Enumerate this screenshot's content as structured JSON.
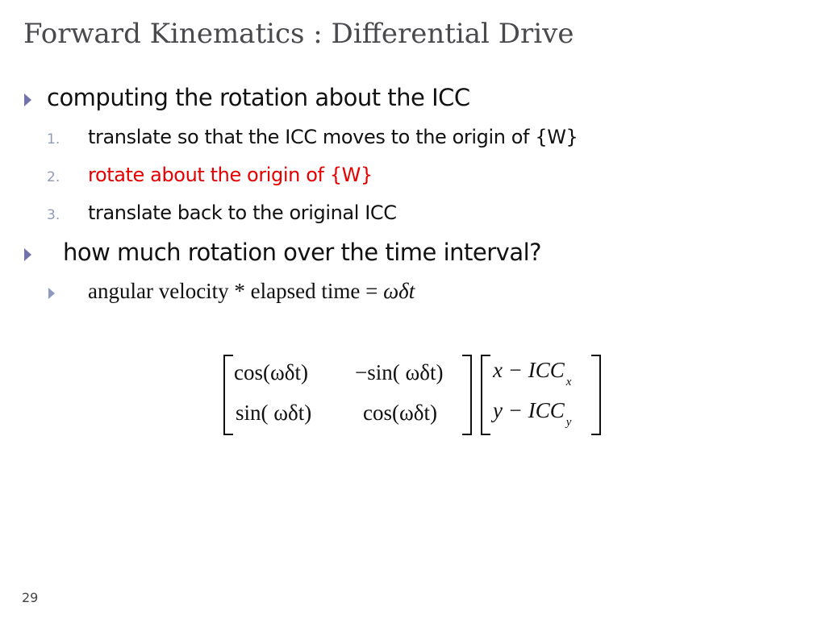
{
  "slide": {
    "title": "Forward Kinematics : Differential Drive",
    "page_number": "29",
    "colors": {
      "title": "#4a4a4e",
      "bullet": "#7174a8",
      "number": "#8e9bb3",
      "highlight": "#e60000",
      "text": "#111111"
    }
  },
  "bullets": [
    {
      "icon": "triangle-bullet-icon",
      "text": "computing the rotation about the ICC",
      "steps": [
        {
          "number": "1.",
          "text": "translate so that the ICC moves to the origin of {W}",
          "highlighted": false
        },
        {
          "number": "2.",
          "text": "rotate about the origin of {W}",
          "highlighted": true
        },
        {
          "number": "3.",
          "text": "translate back to the original ICC",
          "highlighted": false
        }
      ]
    },
    {
      "icon": "triangle-bullet-icon",
      "text": "how much rotation over the time interval?",
      "sub": {
        "icon": "triangle-bullet-icon",
        "text": "angular velocity * elapsed time = ",
        "math": "ωδt"
      }
    }
  ],
  "equation": {
    "matrix": [
      [
        "cos(ωδt)",
        "−sin( ωδt)"
      ],
      [
        "sin( ωδt)",
        "cos(ωδt)"
      ]
    ],
    "vector": [
      {
        "expr": "x − ICC",
        "sub": "x"
      },
      {
        "expr": "y − ICC",
        "sub": "y"
      }
    ]
  }
}
